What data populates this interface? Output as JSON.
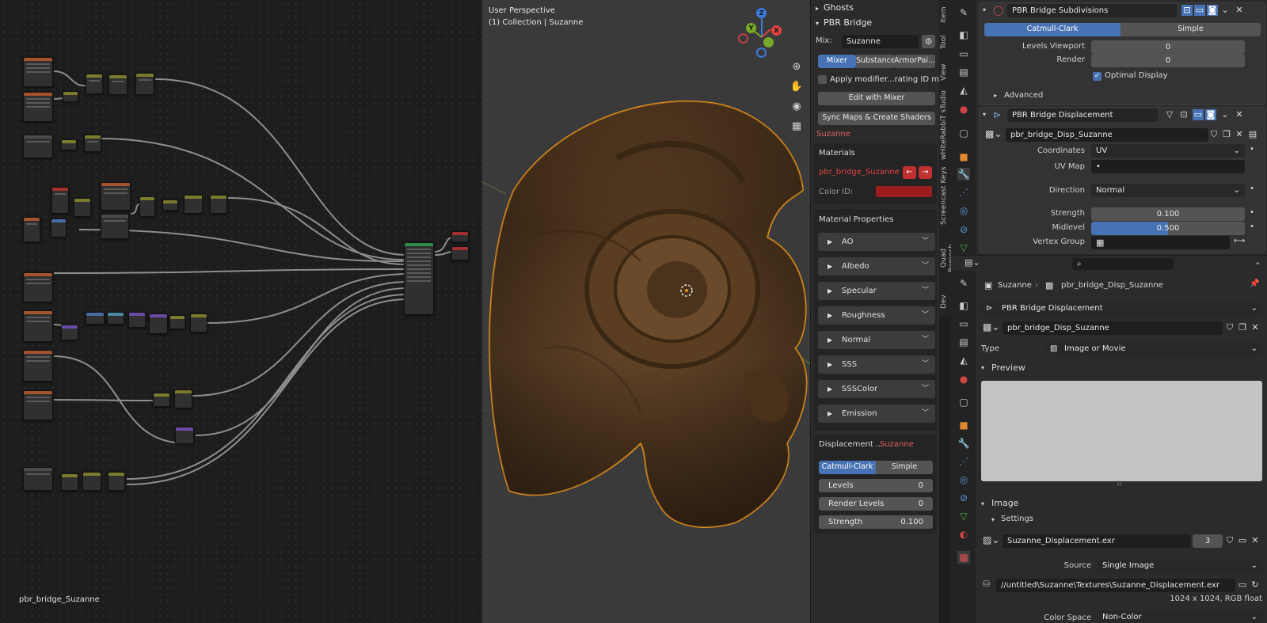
{
  "node_editor": {
    "material_name": "pbr_bridge_Suzanne"
  },
  "viewport": {
    "perspective": "User Perspective",
    "collection": "(1) Collection | Suzanne",
    "gizmo": {
      "z": "Z",
      "y": "Y",
      "x": "X"
    },
    "tools": [
      "zoom-icon",
      "hand-icon",
      "camera-icon",
      "grid-icon"
    ]
  },
  "npanel": {
    "ghosts": "Ghosts",
    "pbr_bridge": "PBR Bridge",
    "mix_label": "Mix:",
    "mix_value": "Suzanne",
    "tabs": [
      "Mixer",
      "Substance",
      "ArmorPai..."
    ],
    "apply_modifiers": "Apply modifier...rating ID maps",
    "edit_with_mixer": "Edit with Mixer",
    "sync_maps": "Sync Maps & Create Shaders",
    "object_name": "Suzanne",
    "materials_header": "Materials",
    "material_name": "pbr_bridge_Suzanne",
    "color_id_label": "Color ID:",
    "color_id_value": "#9b1c1c",
    "material_properties": "Material Properties",
    "channels": [
      "AO",
      "Albedo",
      "Specular",
      "Roughness",
      "Normal",
      "SSS",
      "SSSColor",
      "Emission"
    ],
    "displacement_label": "Displacement ...",
    "displacement_object": "Suzanne",
    "subdiv_tabs": [
      "Catmull-Clark",
      "Simple"
    ],
    "levels_label": "Levels",
    "levels_value": "0",
    "render_levels_label": "Render Levels",
    "render_levels_value": "0",
    "strength_label": "Strength",
    "strength_value": "0.100"
  },
  "vertical_tabs": [
    "Item",
    "Tool",
    "View",
    "wHiteRabbiT sTudio",
    "Screencast Keys",
    "Quad Remesh",
    "Dev"
  ],
  "modifiers": {
    "subdiv_name": "PBR Bridge Subdivisions",
    "subdiv_tabs": [
      "Catmull-Clark",
      "Simple"
    ],
    "levels_viewport_label": "Levels Viewport",
    "levels_viewport_value": "0",
    "render_label": "Render",
    "render_value": "0",
    "optimal_display": "Optimal Display",
    "advanced": "Advanced",
    "disp_name": "PBR Bridge Displacement",
    "texture_name": "pbr_bridge_Disp_Suzanne",
    "coordinates_label": "Coordinates",
    "coordinates_value": "UV",
    "uv_map_label": "UV Map",
    "uv_map_value": "•",
    "direction_label": "Direction",
    "direction_value": "Normal",
    "strength_label": "Strength",
    "strength_value": "0.100",
    "midlevel_label": "Midlevel",
    "midlevel_value": "0.500",
    "vertex_group_label": "Vertex Group"
  },
  "texture_props": {
    "breadcrumb_object": "Suzanne",
    "breadcrumb_texture": "pbr_bridge_Disp_Suzanne",
    "modifier_select": "PBR Bridge Displacement",
    "texture_name": "pbr_bridge_Disp_Suzanne",
    "type_label": "Type",
    "type_value": "Image or Movie",
    "preview": "Preview",
    "image": "Image",
    "settings": "Settings",
    "image_file": "Suzanne_Displacement.exr",
    "image_users": "3",
    "source_label": "Source",
    "source_value": "Single Image",
    "filepath": "//untitled\\Suzanne\\Textures\\Suzanne_Displacement.exr",
    "image_info": "1024 x 1024,  RGB float",
    "color_space_label": "Color Space",
    "color_space_value": "Non-Color"
  }
}
